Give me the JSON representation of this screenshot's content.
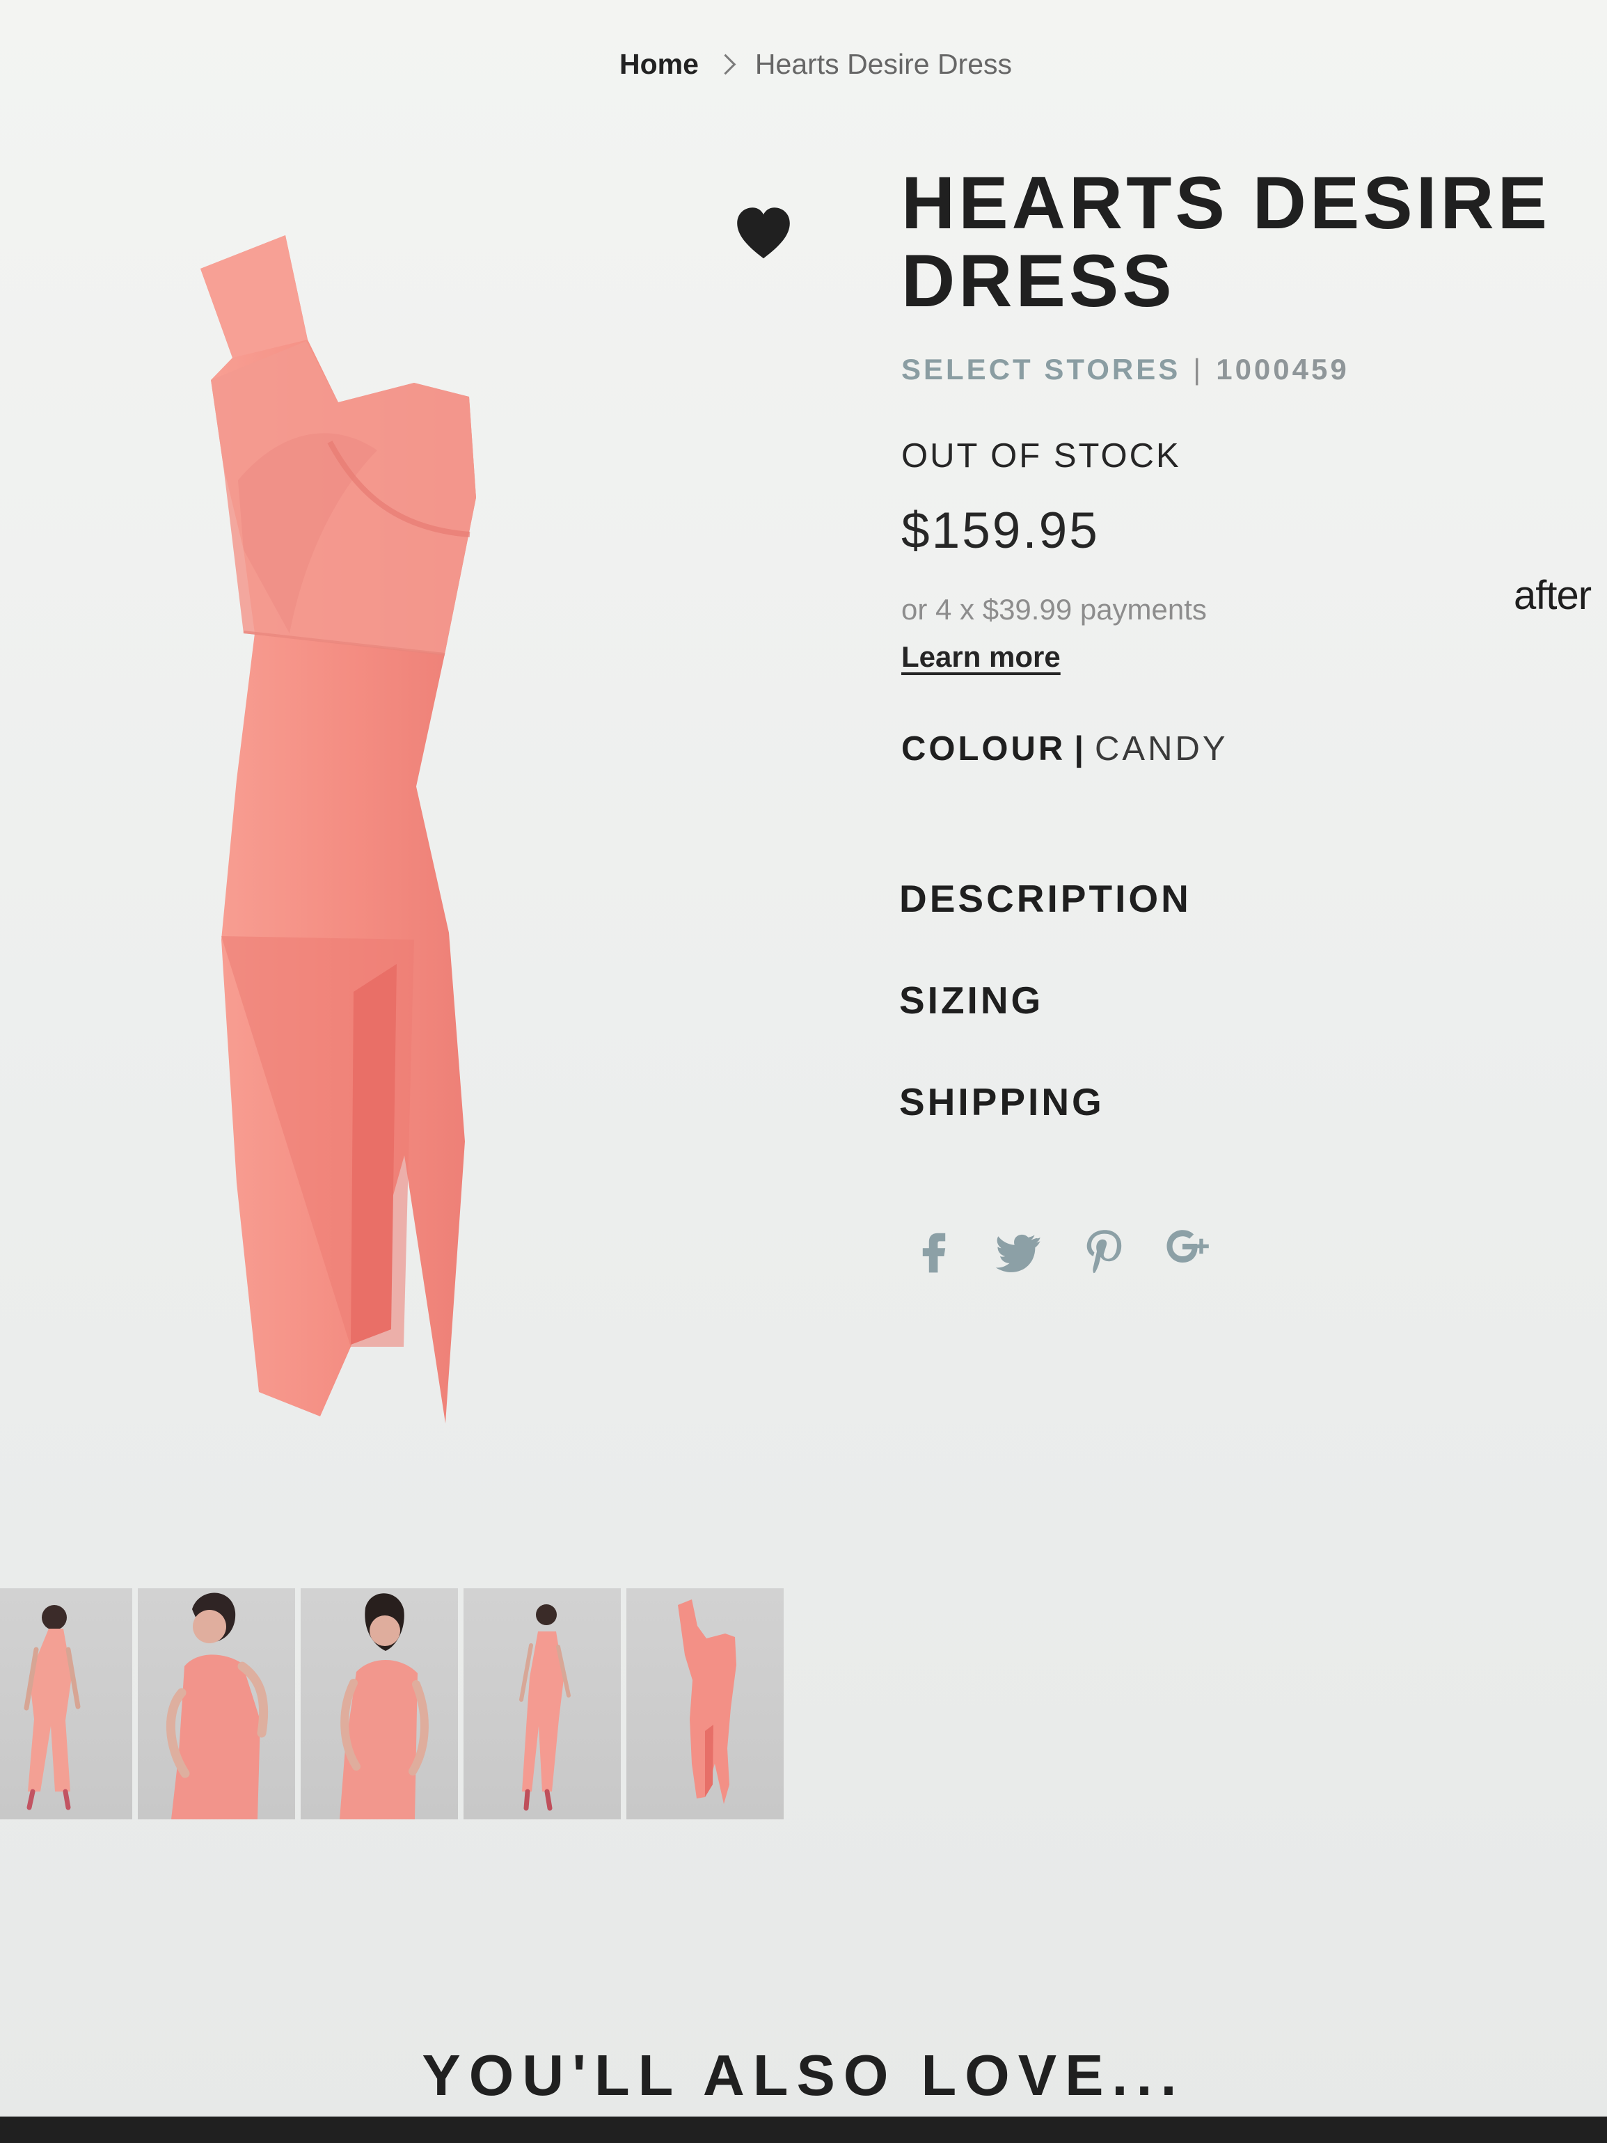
{
  "breadcrumb": {
    "home": "Home",
    "current": "Hearts Desire Dress"
  },
  "product": {
    "title": "HEARTS DESIRE DRESS",
    "availability_label": "SELECT STORES",
    "code": "1000459",
    "stock_status": "OUT OF STOCK",
    "price": "$159.95",
    "installments": "or 4 x $39.99 payments",
    "learn_more": "Learn more",
    "colour_label": "COLOUR",
    "colour_value": "CANDY",
    "afterpay_text": "after"
  },
  "accordion": [
    {
      "label": "DESCRIPTION"
    },
    {
      "label": "SIZING"
    },
    {
      "label": "SHIPPING"
    }
  ],
  "social": [
    {
      "icon": "facebook-icon"
    },
    {
      "icon": "twitter-icon"
    },
    {
      "icon": "pinterest-icon"
    },
    {
      "icon": "google-plus-icon"
    }
  ],
  "thumbnails": [
    {
      "icon": "model-full-length-front"
    },
    {
      "icon": "model-close-up-smiling"
    },
    {
      "icon": "model-back-view"
    },
    {
      "icon": "model-full-length-side"
    },
    {
      "icon": "dress-product-only"
    }
  ],
  "section": {
    "also_love": "YOU'LL ALSO LOVE..."
  },
  "colors": {
    "dress": "#f48e84",
    "dress_shadow": "#ea776e",
    "text": "#202020",
    "muted": "#8d8d8d",
    "accent": "#8a9da2"
  }
}
